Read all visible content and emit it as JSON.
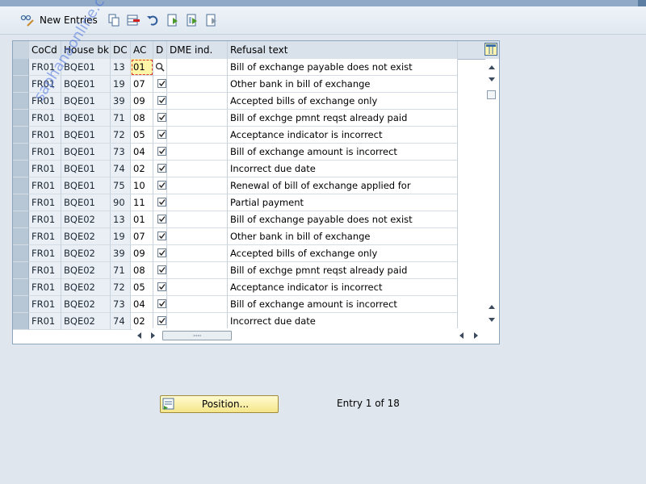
{
  "toolbar": {
    "new_entries_label": "New Entries"
  },
  "table": {
    "columns": [
      "CoCd",
      "House bk",
      "DC",
      "AC",
      "D",
      "DME ind.",
      "Refusal text"
    ],
    "rows": [
      {
        "cocd": "FR01",
        "house_bk": "BQE01",
        "dc": "13",
        "ac": "01",
        "d": false,
        "dme": "",
        "text": "Bill of exchange payable does not exist"
      },
      {
        "cocd": "FR01",
        "house_bk": "BQE01",
        "dc": "19",
        "ac": "07",
        "d": true,
        "dme": "",
        "text": "Other bank in bill of exchange"
      },
      {
        "cocd": "FR01",
        "house_bk": "BQE01",
        "dc": "39",
        "ac": "09",
        "d": true,
        "dme": "",
        "text": "Accepted bills of exchange only"
      },
      {
        "cocd": "FR01",
        "house_bk": "BQE01",
        "dc": "71",
        "ac": "08",
        "d": true,
        "dme": "",
        "text": "Bill of exchge pmnt reqst already paid"
      },
      {
        "cocd": "FR01",
        "house_bk": "BQE01",
        "dc": "72",
        "ac": "05",
        "d": true,
        "dme": "",
        "text": "Acceptance indicator is incorrect"
      },
      {
        "cocd": "FR01",
        "house_bk": "BQE01",
        "dc": "73",
        "ac": "04",
        "d": true,
        "dme": "",
        "text": "Bill of exchange amount is incorrect"
      },
      {
        "cocd": "FR01",
        "house_bk": "BQE01",
        "dc": "74",
        "ac": "02",
        "d": true,
        "dme": "",
        "text": "Incorrect due date"
      },
      {
        "cocd": "FR01",
        "house_bk": "BQE01",
        "dc": "75",
        "ac": "10",
        "d": true,
        "dme": "",
        "text": "Renewal of bill of exchange applied for"
      },
      {
        "cocd": "FR01",
        "house_bk": "BQE01",
        "dc": "90",
        "ac": "11",
        "d": true,
        "dme": "",
        "text": "Partial payment"
      },
      {
        "cocd": "FR01",
        "house_bk": "BQE02",
        "dc": "13",
        "ac": "01",
        "d": true,
        "dme": "",
        "text": "Bill of exchange payable does not exist"
      },
      {
        "cocd": "FR01",
        "house_bk": "BQE02",
        "dc": "19",
        "ac": "07",
        "d": true,
        "dme": "",
        "text": "Other bank in bill of exchange"
      },
      {
        "cocd": "FR01",
        "house_bk": "BQE02",
        "dc": "39",
        "ac": "09",
        "d": true,
        "dme": "",
        "text": "Accepted bills of exchange only"
      },
      {
        "cocd": "FR01",
        "house_bk": "BQE02",
        "dc": "71",
        "ac": "08",
        "d": true,
        "dme": "",
        "text": "Bill of exchge pmnt reqst already paid"
      },
      {
        "cocd": "FR01",
        "house_bk": "BQE02",
        "dc": "72",
        "ac": "05",
        "d": true,
        "dme": "",
        "text": "Acceptance indicator is incorrect"
      },
      {
        "cocd": "FR01",
        "house_bk": "BQE02",
        "dc": "73",
        "ac": "04",
        "d": true,
        "dme": "",
        "text": "Bill of exchange amount is incorrect"
      },
      {
        "cocd": "FR01",
        "house_bk": "BQE02",
        "dc": "74",
        "ac": "02",
        "d": true,
        "dme": "",
        "text": "Incorrect due date"
      }
    ]
  },
  "footer": {
    "position_label": "Position...",
    "entry_text": "Entry 1 of 18"
  },
  "watermark": "saphanaonline.com",
  "icons": {
    "customize": "table-settings-icon",
    "search_help": "search-help-icon"
  }
}
